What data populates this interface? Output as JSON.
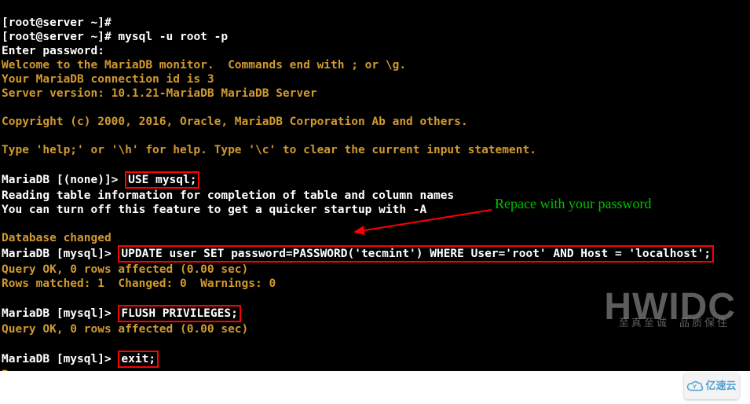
{
  "prompt1": "[root@server ~]#",
  "prompt1b": "[root@server ~]#",
  "cmd_mysql": " mysql -u root -p",
  "enter_pw": "Enter password:",
  "welcome": "Welcome to the MariaDB monitor.  Commands end with ; or \\g.",
  "conn_id": "Your MariaDB connection id is 3",
  "server_ver": "Server version: 10.1.21-MariaDB MariaDB Server",
  "copyright": "Copyright (c) 2000, 2016, Oracle, MariaDB Corporation Ab and others.",
  "help_line": "Type 'help;' or '\\h' for help. Type '\\c' to clear the current input statement.",
  "maria_none_prompt": "MariaDB [(none)]> ",
  "use_mysql": "USE mysql;",
  "reading": "Reading table information for completion of table and column names",
  "turnoff": "You can turn off this feature to get a quicker startup with -A",
  "db_changed": "Database changed",
  "maria_mysql_prompt": "MariaDB [mysql]> ",
  "update_stmt": "UPDATE user SET password=PASSWORD('tecmint') WHERE User='root' AND Host = 'localhost';",
  "query_ok": "Query OK, 0 rows affected (0.00 sec)",
  "rows_matched": "Rows matched: 1  Changed: 0  Warnings: 0",
  "flush_priv": "FLUSH PRIVILEGES;",
  "exit_cmd": "exit;",
  "bye": "Bye",
  "annotation_text": "Repace with your password",
  "watermark_big": "HWIDC",
  "watermark_small": "至真至诚  品质保住",
  "badge_text": "亿速云"
}
